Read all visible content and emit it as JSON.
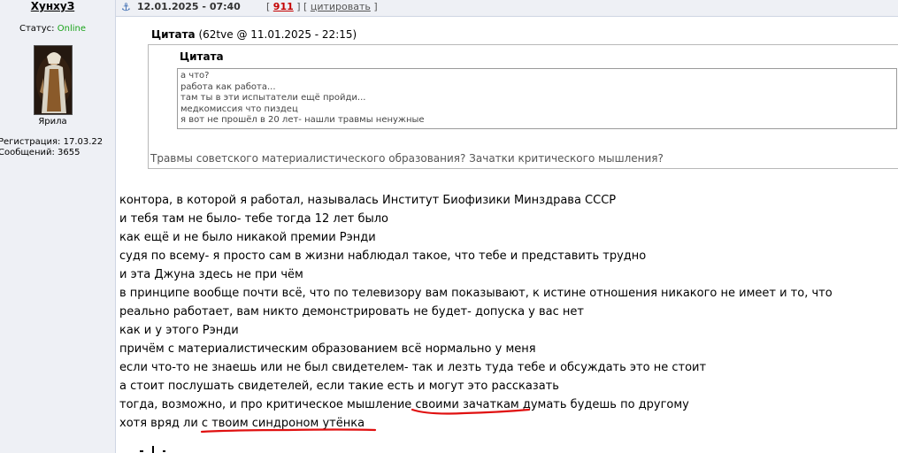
{
  "user": {
    "name": "ХунхуЗ",
    "status_label": "Статус:",
    "status_value": "Online",
    "avatar_caption": "Ярила",
    "registration": "Регистрация: 17.03.22",
    "messages": "Сообщений: 3655"
  },
  "post": {
    "anchor_icon": "anchor-icon",
    "date": "12.01.2025 - 07:40",
    "post_number": "911",
    "quote_link": "цитировать"
  },
  "quote_outer": {
    "title_bold": "Цитата",
    "title_rest": "(62tve @ 11.01.2025 - 22:15)",
    "reply": "Травмы советского материалистического образования? Зачатки критического мышления?"
  },
  "quote_inner": {
    "title": "Цитата",
    "lines": [
      "а что?",
      "работа как работа...",
      "там ты в эти испытатели ещё пройди...",
      "медкомиссия что пиздец",
      "я вот не прошёл в 20 лет- нашли травмы ненужные"
    ]
  },
  "body": {
    "lines": [
      "контора, в которой я работал, называлась Институт Биофизики Минздрава СССР",
      "и тебя там не было- тебе тогда 12 лет было",
      "как ещё и не было никакой премии Рэнди",
      "судя по всему- я просто сам в жизни наблюдал такое, что тебе и представить трудно",
      "и эта Джуна здесь не при чём",
      "в принципе вообще почти всё, что по телевизору вам показывают, к истине отношения никакого не имеет и то, что",
      "реально работает, вам никто демонстрировать не будет- допуска у вас нет",
      "как и у этого Рэнди",
      "причём с материалистическим образованием всё нормально у меня",
      "если что-то не знаешь или не был свидетелем- так и лезть туда тебе и обсуждать это не стоит",
      "а стоит послушать свидетелей, если такие есть и могут это рассказать",
      "тогда, возможно, и про критическое мышление своими зачаткам думать будешь по другому",
      "хотя вряд ли с твоим синдроном утёнка"
    ]
  },
  "colors": {
    "online": "#1aa31a",
    "post_number": "#c40000",
    "underline": "#e01010",
    "sidebar_bg": "#eef0f5"
  }
}
